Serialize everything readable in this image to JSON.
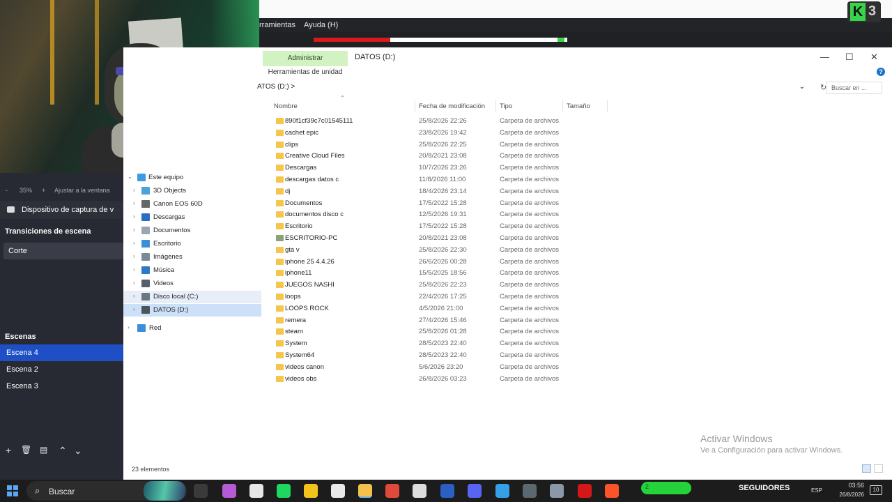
{
  "obs": {
    "menubar": [
      "rramientas",
      "Ayuda (H)"
    ],
    "k_logo": {
      "letter": "K",
      "number": "3"
    },
    "zoom": "35%",
    "zoom_plus": "+",
    "zoom_minus": "-",
    "fit_label": "Ajustar a la ventana",
    "source_label": "Dispositivo de captura de v",
    "transitions_title": "Transiciones de escena",
    "transition_value": "Corte",
    "scenes_title": "Escenas",
    "scenes": [
      "Escena 4",
      "Escena 2",
      "Escena 3"
    ],
    "tools": [
      "+",
      "🗑",
      "▤",
      "⌃",
      "⌄"
    ]
  },
  "explorer": {
    "ribbon_tab": "Administrar",
    "ribbon_tool": "Herramientas de unidad",
    "title": "DATOS (D:)",
    "win_buttons": [
      "—",
      "☐",
      "✕"
    ],
    "address": "ATOS (D:)  >",
    "address_chev": "⌄",
    "search_placeholder": "Buscar en ...",
    "nav": [
      {
        "label": "Este equipo",
        "icon": "computer-icon",
        "color": "#3b9ae1"
      },
      {
        "label": "3D Objects",
        "icon": "cube-icon",
        "color": "#4aa3d4"
      },
      {
        "label": "Canon EOS 60D",
        "icon": "camera-icon",
        "color": "#666666"
      },
      {
        "label": "Descargas",
        "icon": "download-icon",
        "color": "#2b6cc4"
      },
      {
        "label": "Documentos",
        "icon": "document-icon",
        "color": "#9aa5b1"
      },
      {
        "label": "Escritorio",
        "icon": "desktop-icon",
        "color": "#3b8fd6"
      },
      {
        "label": "Imágenes",
        "icon": "image-icon",
        "color": "#7b8a99"
      },
      {
        "label": "Música",
        "icon": "music-icon",
        "color": "#2f78c8"
      },
      {
        "label": "Videos",
        "icon": "video-icon",
        "color": "#55606a"
      },
      {
        "label": "Disco local (C:)",
        "icon": "drive-icon",
        "color": "#6b7780"
      },
      {
        "label": "DATOS (D:)",
        "icon": "drive-icon",
        "color": "#4b545b"
      },
      {
        "label": "Red",
        "icon": "network-icon",
        "color": "#3a8fd8"
      }
    ],
    "columns": [
      "Nombre",
      "Fecha de modificación",
      "Tipo",
      "Tamaño"
    ],
    "files": [
      {
        "name": "890f1cf39c7c01545111",
        "date": "25/8/2026 22:26",
        "type": "Carpeta de archivos"
      },
      {
        "name": "cachet epic",
        "date": "23/8/2026 19:42",
        "type": "Carpeta de archivos"
      },
      {
        "name": "clips",
        "date": "25/8/2026 22:25",
        "type": "Carpeta de archivos"
      },
      {
        "name": "Creative Cloud Files",
        "date": "20/8/2021 23:08",
        "type": "Carpeta de archivos"
      },
      {
        "name": "Descargas",
        "date": "10/7/2026 23:26",
        "type": "Carpeta de archivos"
      },
      {
        "name": "descargas datos c",
        "date": "11/8/2026 11:00",
        "type": "Carpeta de archivos"
      },
      {
        "name": "dj",
        "date": "18/4/2026 23:14",
        "type": "Carpeta de archivos"
      },
      {
        "name": "Documentos",
        "date": "17/5/2022 15:28",
        "type": "Carpeta de archivos"
      },
      {
        "name": "documentos disco c",
        "date": "12/5/2026 19:31",
        "type": "Carpeta de archivos"
      },
      {
        "name": "Escritorio",
        "date": "17/5/2022 15:28",
        "type": "Carpeta de archivos"
      },
      {
        "name": "ESCRITORIO-PC",
        "date": "20/8/2021 23:08",
        "type": "Carpeta de archivos"
      },
      {
        "name": "gta v",
        "date": "25/8/2026 22:30",
        "type": "Carpeta de archivos"
      },
      {
        "name": "iphone 25 4.4.26",
        "date": "26/6/2026 00:28",
        "type": "Carpeta de archivos"
      },
      {
        "name": "iphone11",
        "date": "15/5/2025 18:56",
        "type": "Carpeta de archivos"
      },
      {
        "name": "JUEGOS NASHI",
        "date": "25/8/2026 22:23",
        "type": "Carpeta de archivos"
      },
      {
        "name": "loops",
        "date": "22/4/2026 17:25",
        "type": "Carpeta de archivos"
      },
      {
        "name": "LOOPS ROCK",
        "date": "4/5/2026 21:00",
        "type": "Carpeta de archivos"
      },
      {
        "name": "remera",
        "date": "27/4/2026 15:46",
        "type": "Carpeta de archivos"
      },
      {
        "name": "steam",
        "date": "25/8/2026 01:28",
        "type": "Carpeta de archivos"
      },
      {
        "name": "System",
        "date": "28/5/2023 22:40",
        "type": "Carpeta de archivos"
      },
      {
        "name": "System64",
        "date": "28/5/2023 22:40",
        "type": "Carpeta de archivos"
      },
      {
        "name": "videos canon",
        "date": "5/6/2026 23:20",
        "type": "Carpeta de archivos"
      },
      {
        "name": "videos obs",
        "date": "26/8/2026 03:23",
        "type": "Carpeta de archivos"
      }
    ],
    "status": "23 elementos",
    "watermark_title": "Activar Windows",
    "watermark_sub": "Ve a Configuración para activar Windows."
  },
  "taskbar": {
    "search_label": "Buscar",
    "apps": [
      {
        "name": "task-view-icon",
        "color": "#3a3a3a"
      },
      {
        "name": "copilot-icon",
        "color": "#b65bd6"
      },
      {
        "name": "obs-icon",
        "color": "#e6e6e6"
      },
      {
        "name": "spotify-icon",
        "color": "#1ed760"
      },
      {
        "name": "coin-icon",
        "color": "#f2c318"
      },
      {
        "name": "shield-icon",
        "color": "#e8e8e8"
      },
      {
        "name": "file-explorer-icon",
        "color": "#f4c24b"
      },
      {
        "name": "media-player-icon",
        "color": "#e04a3a"
      },
      {
        "name": "m-app-icon",
        "color": "#dddddd"
      },
      {
        "name": "word-icon",
        "color": "#2b5fc4"
      },
      {
        "name": "discord-icon",
        "color": "#5865f2"
      },
      {
        "name": "cloud-icon",
        "color": "#35a0e6"
      },
      {
        "name": "calculator-icon",
        "color": "#5c6870"
      },
      {
        "name": "game-icon",
        "color": "#8a98a8"
      },
      {
        "name": "red-app-icon",
        "color": "#d41818"
      },
      {
        "name": "brave-icon",
        "color": "#fb542b"
      }
    ],
    "seguidores_num": "2",
    "seguidores_label": "SEGUIDORES",
    "lang": "ESP",
    "time": "03:56",
    "date": "26/8/2026",
    "notif": "10"
  }
}
